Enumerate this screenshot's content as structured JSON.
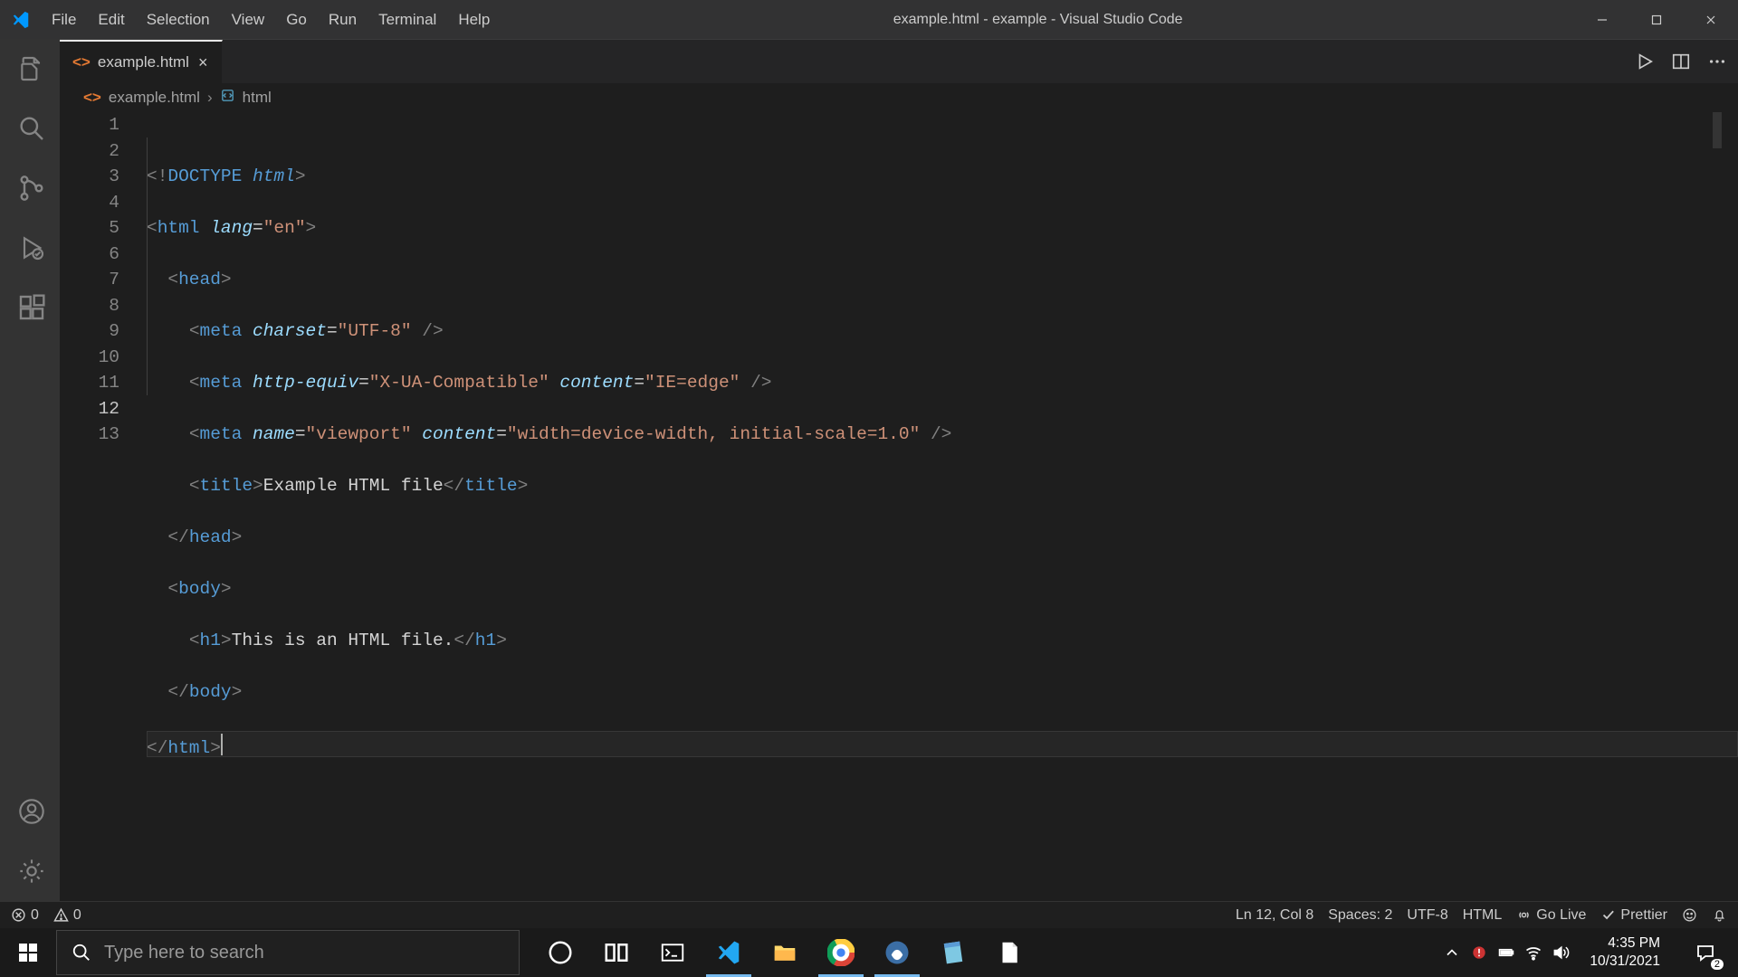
{
  "window": {
    "title": "example.html - example - Visual Studio Code"
  },
  "menu": [
    "File",
    "Edit",
    "Selection",
    "View",
    "Go",
    "Run",
    "Terminal",
    "Help"
  ],
  "tab": {
    "filename": "example.html"
  },
  "breadcrumb": {
    "file": "example.html",
    "symbol": "html"
  },
  "lines": [
    "1",
    "2",
    "3",
    "4",
    "5",
    "6",
    "7",
    "8",
    "9",
    "10",
    "11",
    "12",
    "13"
  ],
  "active_line_index": 11,
  "code": {
    "doctype_bang": "!",
    "doctype": "DOCTYPE",
    "doctype_html": "html",
    "html": "html",
    "lang_attr": "lang",
    "lang_val": "\"en\"",
    "head": "head",
    "meta": "meta",
    "charset_attr": "charset",
    "charset_val": "\"UTF-8\"",
    "httpequiv_attr": "http-equiv",
    "httpequiv_val": "\"X-UA-Compatible\"",
    "content_attr": "content",
    "content_ie_val": "\"IE=edge\"",
    "name_attr": "name",
    "viewport_val": "\"viewport\"",
    "content_vp_val": "\"width=device-width, initial-scale=1.0\"",
    "title": "title",
    "title_text": "Example HTML file",
    "body": "body",
    "h1": "h1",
    "h1_text": "This is an HTML file.",
    "close_head": "head",
    "close_body": "body",
    "close_html": "html"
  },
  "status": {
    "errors": "0",
    "warnings": "0",
    "cursor": "Ln 12, Col 8",
    "spaces": "Spaces: 2",
    "encoding": "UTF-8",
    "language": "HTML",
    "golive": "Go Live",
    "prettier": "Prettier"
  },
  "taskbar": {
    "search_placeholder": "Type here to search",
    "time": "4:35 PM",
    "date": "10/31/2021",
    "notif_count": "2"
  }
}
